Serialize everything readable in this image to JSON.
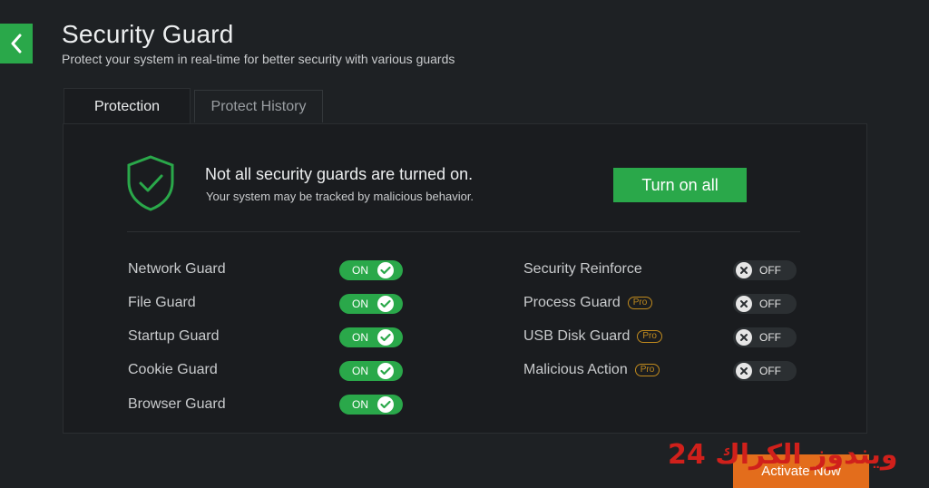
{
  "header": {
    "back_icon": "chevron-left-icon",
    "title": "Security Guard",
    "subtitle": "Protect your system in real-time for better security with various guards"
  },
  "tabs": [
    {
      "label": "Protection",
      "active": true
    },
    {
      "label": "Protect History",
      "active": false
    }
  ],
  "alert": {
    "icon": "shield-check-icon",
    "title": "Not all security guards are turned on.",
    "subtitle": "Your system may be tracked by malicious behavior.",
    "button_label": "Turn on all"
  },
  "left_guards": [
    {
      "label": "Network Guard",
      "state": "ON"
    },
    {
      "label": "File Guard",
      "state": "ON"
    },
    {
      "label": "Startup Guard",
      "state": "ON"
    },
    {
      "label": "Cookie Guard",
      "state": "ON"
    },
    {
      "label": "Browser Guard",
      "state": "ON"
    }
  ],
  "right_guards": [
    {
      "label": "Security Reinforce",
      "state": "OFF",
      "pro": ""
    },
    {
      "label": "Process Guard",
      "state": "OFF",
      "pro": "Pro"
    },
    {
      "label": "USB Disk Guard",
      "state": "OFF",
      "pro": "Pro"
    },
    {
      "label": "Malicious Action",
      "state": "OFF",
      "pro": "Pro"
    }
  ],
  "footer": {
    "activate_label": "Activate Now",
    "watermark": "24 ويندوز الكراك"
  },
  "colors": {
    "accent_green": "#2aa84a",
    "background": "#1e2124",
    "panel": "#1a1c1f",
    "pro_badge": "#c08a1e",
    "activate_orange": "#e36d1c"
  }
}
